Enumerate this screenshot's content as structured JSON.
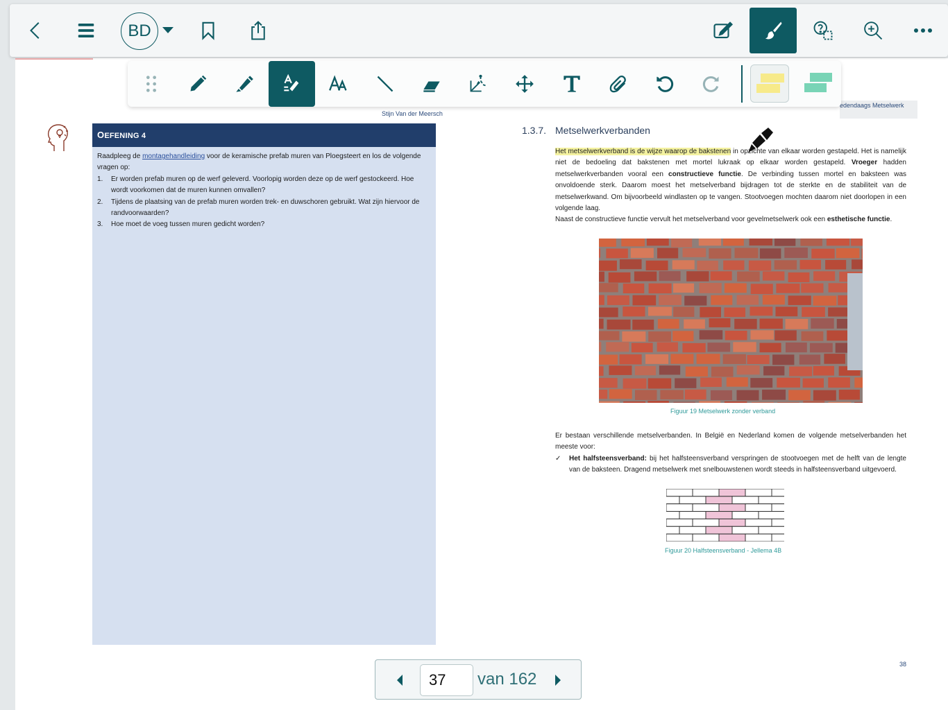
{
  "topbar": {
    "avatar_initials": "BD",
    "icons": [
      "back-icon",
      "menu-icon",
      "chevron-down-icon",
      "bookmark-icon",
      "share-icon",
      "edit-note-icon",
      "brush-icon",
      "help-select-icon",
      "zoom-in-icon",
      "more-icon"
    ],
    "active_tool": "brush",
    "accent": "#0e5a62"
  },
  "annotation_toolbar": {
    "tools": [
      "drag-handle",
      "pencil",
      "highlighter",
      "smart-highlighter",
      "text-style",
      "line",
      "eraser",
      "lasso",
      "move",
      "text",
      "attach",
      "undo",
      "redo"
    ],
    "active_tool": "smart-highlighter",
    "colors": {
      "selected": "#f7ea8a",
      "alternate": "#79d4b6"
    }
  },
  "left_page": {
    "author": "Stijn Van der Meersch",
    "exercise_title_prefix": "O",
    "exercise_title_rest": "EFENING 4",
    "intro_before": "Raadpleeg de ",
    "intro_link": "montagehandleiding",
    "intro_after": " voor de keramische prefab muren van Ploegsteert en los de volgende vragen op:",
    "questions": [
      {
        "num": "1.",
        "text": "Er worden prefab muren op de werf geleverd. Voorlopig worden deze op de werf gestockeerd. Hoe wordt voorkomen dat de muren kunnen omvallen?"
      },
      {
        "num": "2.",
        "text": "Tijdens de plaatsing van de prefab muren worden trek- en duwschoren gebruikt. Wat zijn hiervoor de randvoorwaarden?"
      },
      {
        "num": "3.",
        "text": "Hoe moet de voeg tussen muren gedicht worden?"
      }
    ],
    "box_color": "#d6e0f0",
    "header_color": "#213e6b"
  },
  "right_page": {
    "running_header": "edendaags Metselwerk",
    "section_number": "1.3.7.",
    "section_title": "Metselwerkverbanden",
    "p1_highlighted": "Het metselwerkverband is de wijze waarop de bakstenen",
    "p1_rest_a": " in opzichte van elkaar worden gestapeld. Het is namelijk niet de bedoeling dat bakstenen met mortel lukraak op elkaar worden gestapeld. ",
    "p1_bold_a": "Vroeger",
    "p1_rest_b": " hadden metselwerkverbanden vooral een ",
    "p1_bold_b": "constructieve functie",
    "p1_rest_c": ". De verbinding tussen mortel en baksteen was onvoldoende sterk. Daarom moest het metselverband bijdragen tot de sterkte en de stabiliteit van de metselwerkwand. Om bijvoorbeeld windlasten op te vangen. Stootvoegen mochten daarom niet doorlopen in een volgende laag.",
    "p2_text": "Naast de constructieve functie vervult het metselverband voor gevelmetselwerk ook een ",
    "p2_bold": "esthetische functie",
    "p2_end": ".",
    "figure19_caption": "Figuur 19  Metselwerk zonder verband",
    "p3": "Er bestaan verschillende metselverbanden. In België en Nederland komen de volgende metselverbanden het meeste voor:",
    "bullet_mark": "✓",
    "bullet_bold": "Het halfsteensverband:",
    "bullet_text": " bij het halfsteensverband verspringen de stootvoegen met de helft van de lengte van de baksteen. Dragend metselwerk met snelbouwstenen wordt steeds in halfsteensverband uitgevoerd.",
    "figure20_caption": "Figuur 20  Halfsteensverband - Jellema 4B",
    "page_number": "38",
    "highlight_color": "#f4f2a0",
    "caption_color": "#2f9a9a"
  },
  "pager": {
    "current": "37",
    "of_label": "van 162"
  }
}
